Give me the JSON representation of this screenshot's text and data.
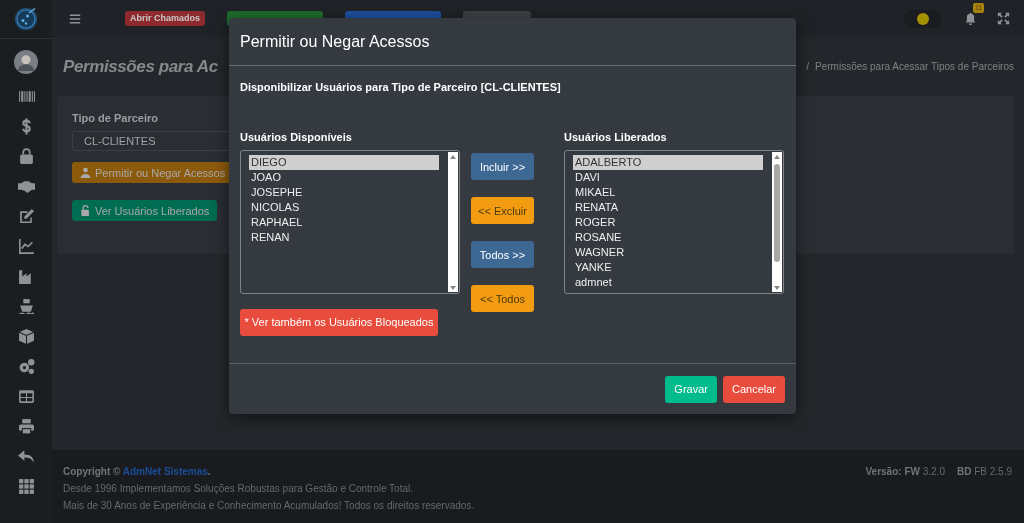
{
  "header": {
    "badges": [
      {
        "label": "Abrir Chamados",
        "color": "#8e2a2e"
      },
      {
        "color": "#1f6b2c"
      },
      {
        "color": "#1d4f9c"
      },
      {
        "color": "#3d4043"
      }
    ],
    "theme_toggle": {
      "on": true
    },
    "notification_count": "11"
  },
  "page": {
    "title": "Permissões para Ac",
    "breadcrumb_separator": "/",
    "breadcrumb": "Permissões para Acessar Tipos de Parceiros"
  },
  "form": {
    "label": "Tipo de Parceiro",
    "value": "CL-CLIENTES",
    "buttons": [
      {
        "label": "Permitir ou Negar Acessos",
        "kind": "warning"
      },
      {
        "label": "Ver Usuários Liberados",
        "kind": "success"
      }
    ]
  },
  "modal": {
    "title": "Permitir ou Negar Acessos",
    "subtitle": "Disponibilizar Usuários para Tipo de Parceiro [CL-CLIENTES]",
    "available": {
      "label": "Usuários Disponíveis",
      "scrollable": false,
      "items": [
        {
          "name": "DIEGO",
          "selected": true
        },
        {
          "name": "JOAO",
          "selected": false
        },
        {
          "name": "JOSEPHE",
          "selected": false
        },
        {
          "name": "NICOLAS",
          "selected": false
        },
        {
          "name": "RAPHAEL",
          "selected": false
        },
        {
          "name": "RENAN",
          "selected": false
        }
      ]
    },
    "transfer_buttons": [
      {
        "label": "Incluir >>",
        "kind": "primary"
      },
      {
        "label": "<< Excluir",
        "kind": "warning"
      },
      {
        "label": "Todos >>",
        "kind": "primary"
      },
      {
        "label": "<< Todos",
        "kind": "warning"
      }
    ],
    "released": {
      "label": "Usuários Liberados",
      "scrollable": true,
      "items": [
        {
          "name": "ADALBERTO",
          "selected": true
        },
        {
          "name": "DAVI",
          "selected": false
        },
        {
          "name": "MIKAEL",
          "selected": false
        },
        {
          "name": "RENATA",
          "selected": false
        },
        {
          "name": "ROGER",
          "selected": false
        },
        {
          "name": "ROSANE",
          "selected": false
        },
        {
          "name": "WAGNER",
          "selected": false
        },
        {
          "name": "YANKE",
          "selected": false
        },
        {
          "name": "admnet",
          "selected": false
        }
      ]
    },
    "blocked_button": {
      "label": "* Ver também os Usuários Bloqueados",
      "kind": "danger"
    },
    "footer_buttons": [
      {
        "label": "Gravar",
        "kind": "success"
      },
      {
        "label": "Cancelar",
        "kind": "danger"
      }
    ]
  },
  "footer": {
    "copyright": {
      "before": "Copyright © ",
      "link": "AdmNet Sistemas",
      "after": "."
    },
    "lines": [
      "Desde 1996 Implementamos Soluções Robustas para Gestão e Controle Total.",
      "Mais de 30 Anos de Experiência e Conhecimento Acumulados! Todos os direitos reservados."
    ],
    "versions": [
      "**Versão: FW** 3.2.0",
      "**BD** FB 2.5.9"
    ]
  }
}
